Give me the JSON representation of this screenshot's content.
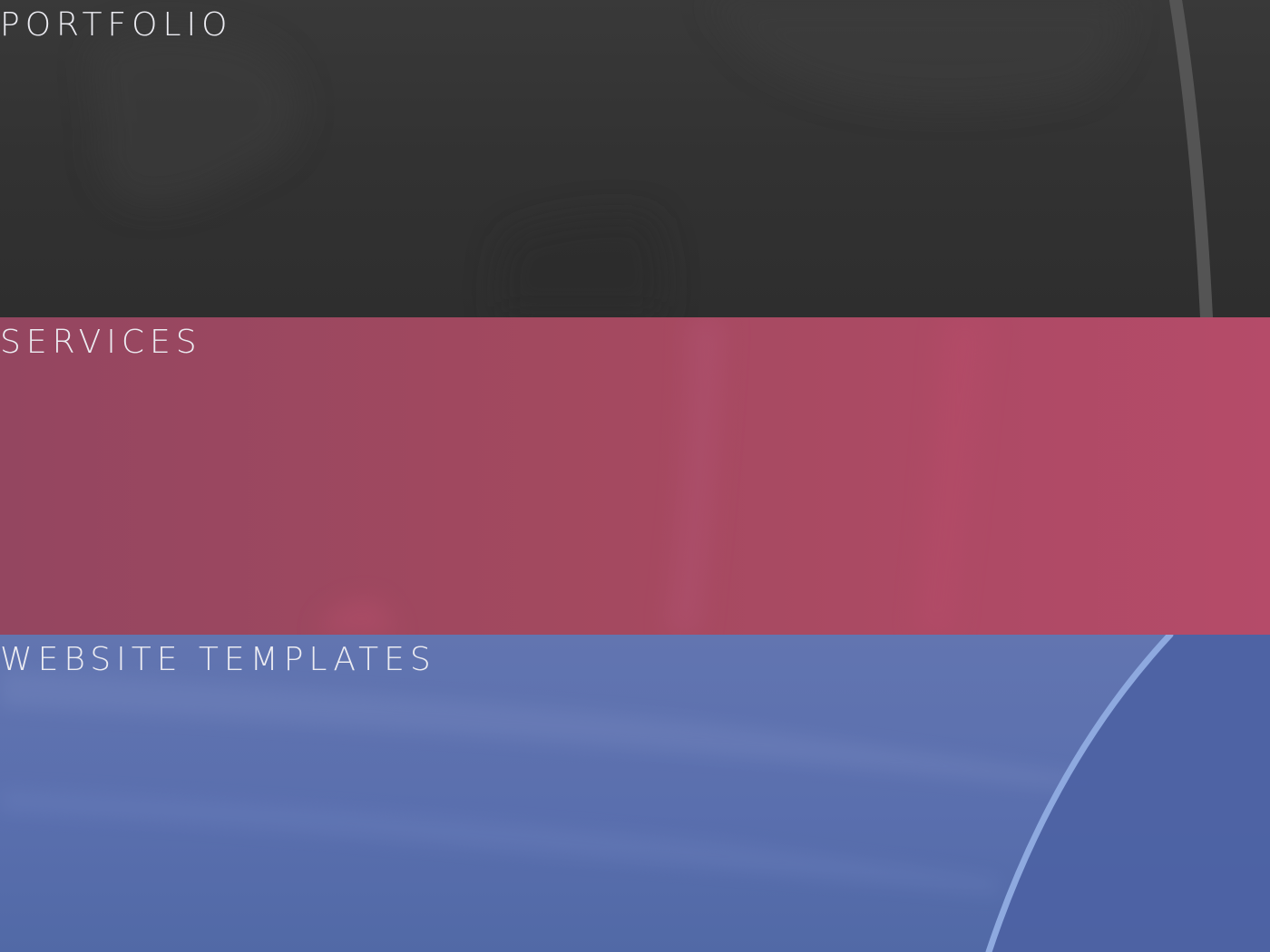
{
  "panels": [
    {
      "id": "portfolio",
      "label": "PORTFOLIO",
      "color": "#333333"
    },
    {
      "id": "services",
      "label": "SERVICES",
      "color": "#a6485f"
    },
    {
      "id": "website-templates",
      "label": "WEBSITE TEMPLATES",
      "color": "#5a6fae"
    }
  ],
  "label_color": "#ececf2"
}
